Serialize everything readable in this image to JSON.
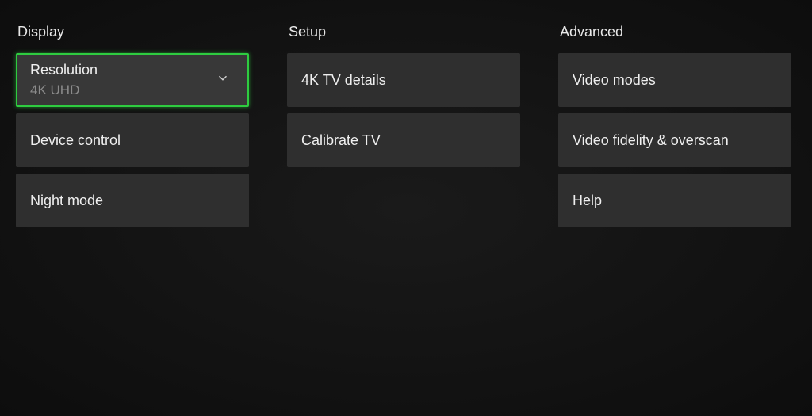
{
  "columns": {
    "display": {
      "header": "Display",
      "resolution": {
        "label": "Resolution",
        "value": "4K UHD"
      },
      "device_control": "Device control",
      "night_mode": "Night mode"
    },
    "setup": {
      "header": "Setup",
      "tv_details": "4K TV details",
      "calibrate_tv": "Calibrate TV"
    },
    "advanced": {
      "header": "Advanced",
      "video_modes": "Video modes",
      "video_fidelity": "Video fidelity & overscan",
      "help": "Help"
    }
  }
}
